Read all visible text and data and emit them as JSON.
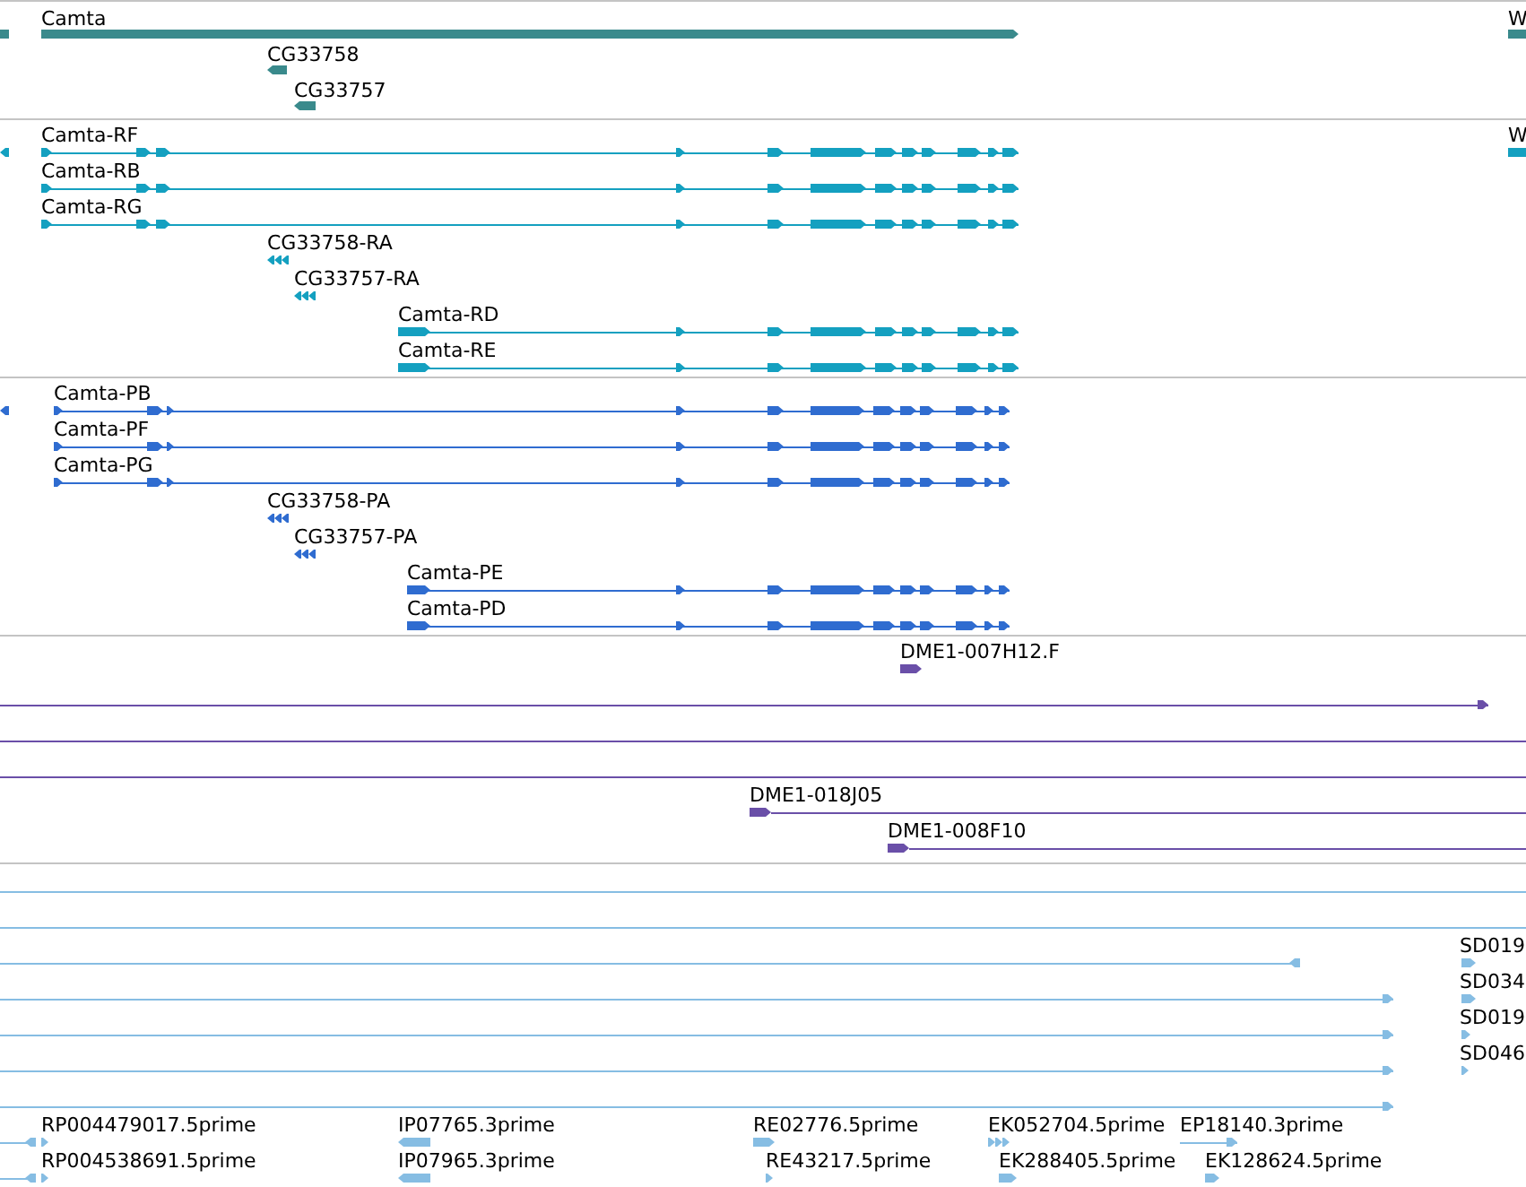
{
  "tracks": [
    {
      "kind": "gene",
      "color": "#3a8a8c",
      "features": [
        {
          "label": "Camta"
        },
        {
          "label": "CG33758"
        },
        {
          "label": "CG33757"
        },
        {
          "label": "W"
        }
      ]
    },
    {
      "kind": "transcript",
      "color": "#14a0c0",
      "features": [
        {
          "label": "Camta-RF"
        },
        {
          "label": "Camta-RB"
        },
        {
          "label": "Camta-RG"
        },
        {
          "label": "CG33758-RA"
        },
        {
          "label": "CG33757-RA"
        },
        {
          "label": "Camta-RD"
        },
        {
          "label": "Camta-RE"
        },
        {
          "label": "W"
        }
      ]
    },
    {
      "kind": "protein",
      "color": "#2f6cd0",
      "features": [
        {
          "label": "Camta-PB"
        },
        {
          "label": "Camta-PF"
        },
        {
          "label": "Camta-PG"
        },
        {
          "label": "CG33758-PA"
        },
        {
          "label": "CG33757-PA"
        },
        {
          "label": "Camta-PE"
        },
        {
          "label": "Camta-PD"
        }
      ]
    },
    {
      "kind": "clone",
      "color": "#6a4fa8",
      "features": [
        {
          "label": "DME1-007H12.F"
        },
        {
          "label": "DME1-018J05"
        },
        {
          "label": "DME1-008F10"
        }
      ]
    },
    {
      "kind": "est",
      "color": "#86bde3",
      "features": [
        {
          "label": "SD019"
        },
        {
          "label": "SD034"
        },
        {
          "label": "SD019"
        },
        {
          "label": "SD046"
        },
        {
          "label": "RP004479017.5prime"
        },
        {
          "label": "RP004538691.5prime"
        },
        {
          "label": "IP07765.3prime"
        },
        {
          "label": "IP07965.3prime"
        },
        {
          "label": "RE02776.5prime"
        },
        {
          "label": "RE43217.5prime"
        },
        {
          "label": "EK052704.5prime"
        },
        {
          "label": "EP18140.3prime"
        },
        {
          "label": "EK288405.5prime"
        },
        {
          "label": "EK128624.5prime"
        }
      ]
    }
  ]
}
